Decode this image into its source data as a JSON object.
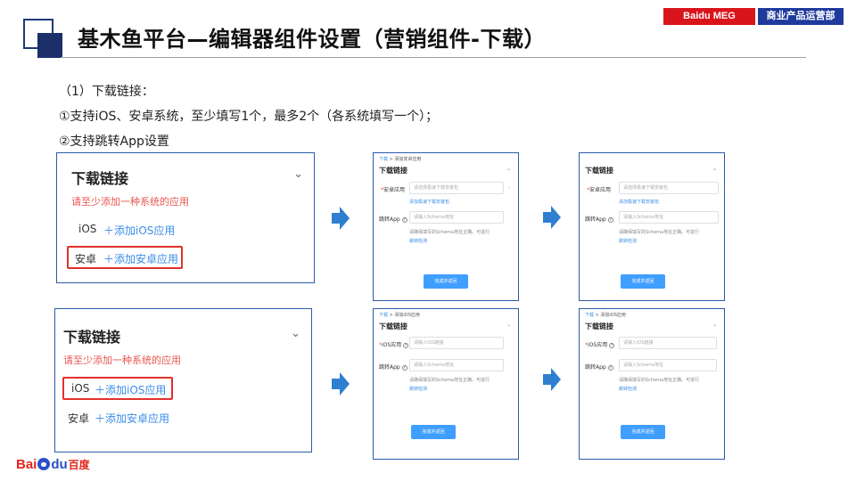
{
  "header": {
    "title": "基木鱼平台—编辑器组件设置（营销组件-下载）",
    "badge_left": "Baidu MEG",
    "badge_right": "商业产品运营部"
  },
  "body": {
    "line1": "（1）下载链接：",
    "line2": "①支持iOS、安卓系统，至少填写1个，最多2个（各系统填写一个）；",
    "line3": "②支持跳转App设置"
  },
  "panel_a": {
    "title": "下载链接",
    "warning": "请至少添加一种系统的应用",
    "row1_label": "iOS",
    "row1_link": "＋添加iOS应用",
    "row2_label": "安卓",
    "row2_link": "＋添加安卓应用"
  },
  "panel_b": {
    "title": "下载链接",
    "warning": "请至少添加一种系统的应用",
    "row1_label": "iOS",
    "row1_link": "＋添加iOS应用",
    "row2_label": "安卓",
    "row2_link": "＋添加安卓应用"
  },
  "forms": {
    "android_1": {
      "bc_root": "下载",
      "bc_sep": ">",
      "bc_page": "添加安卓应用",
      "title": "下载链接",
      "field1_star": "*",
      "field1_label": "安卓应用",
      "field1_placeholder": "请选择极速下载安装包",
      "field1_help": "添加极速下载安装包",
      "field2_label": "跳转App",
      "field2_placeholder": "请输入Schema地址",
      "field2_help": "请确保填写的Schema地址正确。可进行",
      "field2_link": "跳转检测",
      "button": "完成并返回"
    },
    "android_2": {
      "title": "下载链接",
      "field1_star": "*",
      "field1_label": "安卓应用",
      "field1_placeholder": "请选择极速下载安装包",
      "field1_help": "添加极速下载安装包",
      "field2_label": "跳转App",
      "field2_placeholder": "请输入Schema地址",
      "field2_help": "请确保填写的Schema地址正确。可进行",
      "field2_link": "跳转检测",
      "button": "完成并返回"
    },
    "ios_1": {
      "bc_root": "下载",
      "bc_sep": ">",
      "bc_page": "添加iOS应用",
      "title": "下载链接",
      "field1_star": "*",
      "field1_label": "iOS应用",
      "field1_placeholder": "请输入iOS链接",
      "field2_label": "跳转App",
      "field2_placeholder": "请输入Schema地址",
      "field2_help": "请确保填写的Schema地址正确。可进行",
      "field2_link": "跳转检测",
      "button": "完成并返回"
    },
    "ios_2": {
      "bc_root": "下载",
      "bc_sep": ">",
      "bc_page": "添加iOS应用",
      "title": "下载链接",
      "field1_star": "*",
      "field1_label": "iOS应用",
      "field1_placeholder": "请输入iOS链接",
      "field2_label": "跳转App",
      "field2_placeholder": "请输入Schema地址",
      "field2_help": "请确保填写的Schema地址正确。可进行",
      "field2_link": "跳转检测",
      "button": "完成并返回"
    }
  },
  "footer": {
    "logo_bai": "Bai",
    "logo_du": "du",
    "logo_cn": "百度"
  },
  "colors": {
    "accent_blue": "#409eff",
    "panel_border": "#2c5ba8",
    "warn_red": "#e8564f",
    "highlight_red": "#e0312c",
    "arrow_blue": "#2f7fd0",
    "badge_red": "#d9141b",
    "badge_blue": "#1f3a9c"
  },
  "icons": [
    "chevron-down-icon",
    "arrow-right-icon",
    "help-circle-icon",
    "baidu-paw-icon"
  ]
}
